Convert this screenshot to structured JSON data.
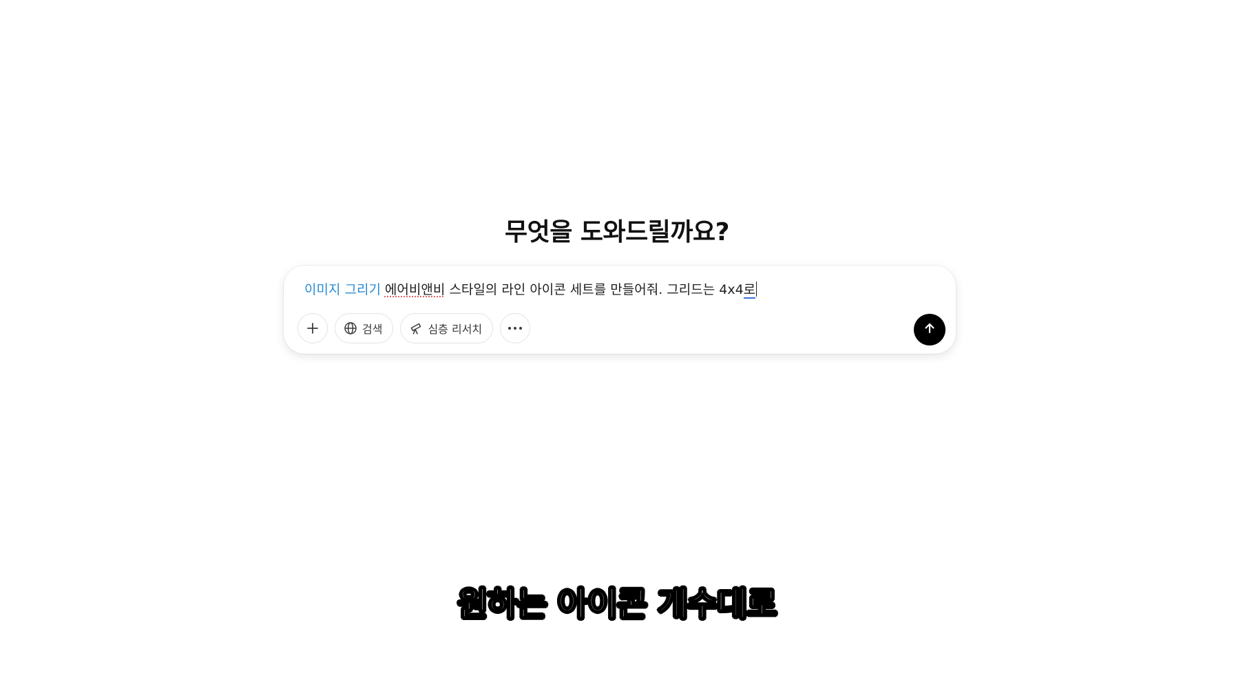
{
  "heading": "무엇을 도와드릴까요?",
  "composer": {
    "mode_tag": "이미지 그리기",
    "text_part1": "에어비앤비",
    "text_part2": " 스타일의 라인 아이콘 세트를 만들어줘. 그리드는 4x4",
    "text_composing": "로",
    "toolbar": {
      "add_icon": "plus-icon",
      "search_label": "검색",
      "search_icon": "globe-icon",
      "research_label": "심층 리서치",
      "research_icon": "telescope-icon",
      "more_icon": "more-dots-icon"
    },
    "send_icon": "arrow-up-icon"
  },
  "caption": "원하는 아이콘 개수대로",
  "colors": {
    "mode_tag": "#2a8bd4",
    "send_button": "#000000",
    "text": "#1f1f1f"
  }
}
